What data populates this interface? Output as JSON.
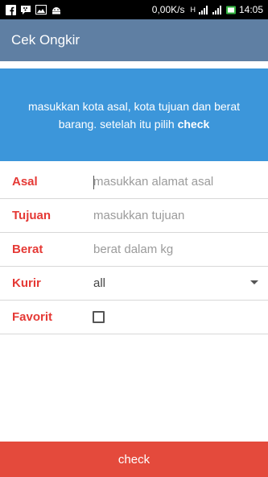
{
  "status_bar": {
    "network_speed": "0,00K/s",
    "signal_label": "H",
    "time": "14:05",
    "icons": [
      "facebook-icon",
      "bbm-icon",
      "gallery-icon",
      "android-icon",
      "signal-icon",
      "battery-icon"
    ]
  },
  "app_bar": {
    "title": "Cek Ongkir"
  },
  "banner": {
    "text_before": "masukkan kota asal, kota tujuan dan berat barang. setelah itu pilih ",
    "text_bold": "check"
  },
  "form": {
    "asal": {
      "label": "Asal",
      "placeholder": "masukkan alamat asal"
    },
    "tujuan": {
      "label": "Tujuan",
      "placeholder": "masukkan tujuan"
    },
    "berat": {
      "label": "Berat",
      "placeholder": "berat dalam kg"
    },
    "kurir": {
      "label": "Kurir",
      "selected": "all"
    },
    "favorit": {
      "label": "Favorit",
      "checked": false
    }
  },
  "button": {
    "label": "check"
  },
  "colors": {
    "app_bar": "#5f7fa3",
    "banner": "#3c96da",
    "label": "#e53935",
    "button": "#e44a3c"
  }
}
